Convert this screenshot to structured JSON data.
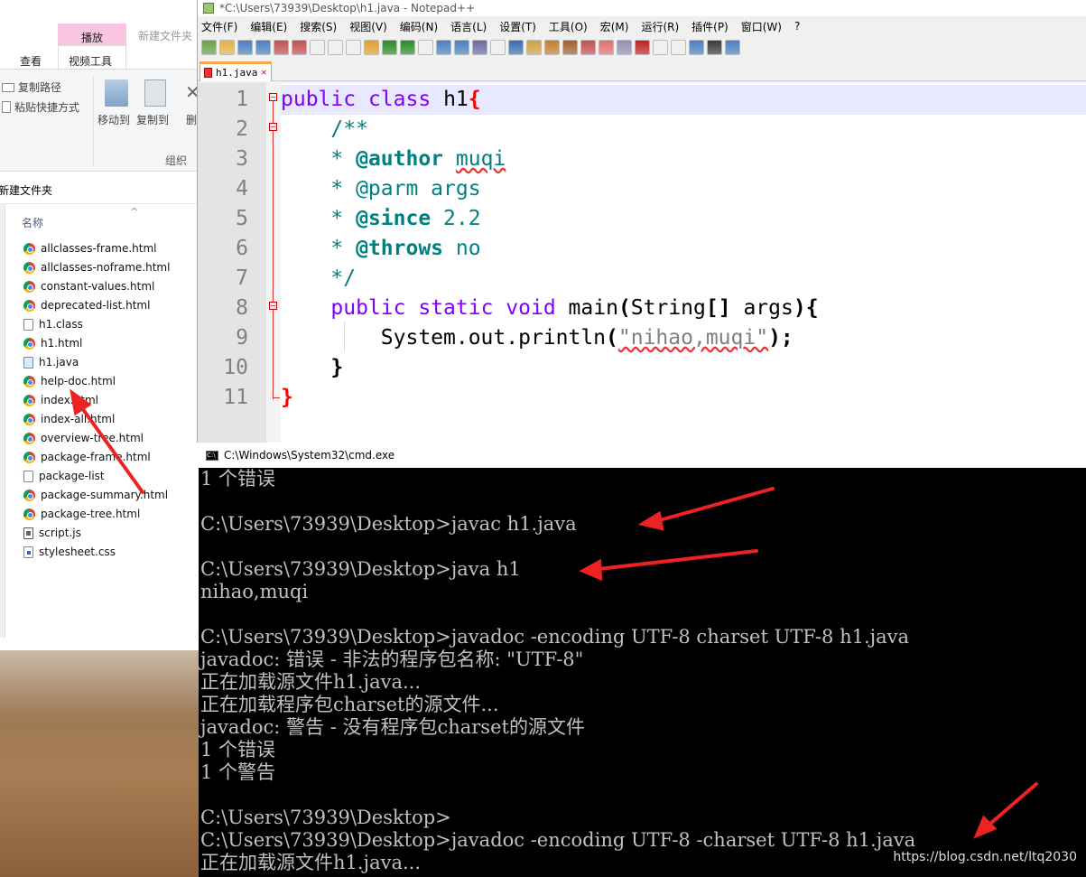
{
  "explorer": {
    "tab_play": "播放",
    "tab_newfolder": "新建文件夹",
    "tab_view": "查看",
    "tab_videotools": "视频工具",
    "ribbon_copy_path": "复制路径",
    "ribbon_paste_shortcut": "粘贴快捷方式",
    "ribbon_move_to": "移动到",
    "ribbon_copy_to": "复制到",
    "ribbon_delete": "删",
    "ribbon_group": "组织",
    "breadcrumb": "新建文件夹",
    "col_name": "名称",
    "files": [
      {
        "name": "allclasses-frame.html",
        "type": "chrome"
      },
      {
        "name": "allclasses-noframe.html",
        "type": "chrome"
      },
      {
        "name": "constant-values.html",
        "type": "chrome"
      },
      {
        "name": "deprecated-list.html",
        "type": "chrome"
      },
      {
        "name": "h1.class",
        "type": "doc"
      },
      {
        "name": "h1.html",
        "type": "chrome"
      },
      {
        "name": "h1.java",
        "type": "java"
      },
      {
        "name": "help-doc.html",
        "type": "chrome"
      },
      {
        "name": "index.html",
        "type": "chrome"
      },
      {
        "name": "index-all.html",
        "type": "chrome"
      },
      {
        "name": "overview-tree.html",
        "type": "chrome"
      },
      {
        "name": "package-frame.html",
        "type": "chrome"
      },
      {
        "name": "package-list",
        "type": "doc"
      },
      {
        "name": "package-summary.html",
        "type": "chrome"
      },
      {
        "name": "package-tree.html",
        "type": "chrome"
      },
      {
        "name": "script.js",
        "type": "js"
      },
      {
        "name": "stylesheet.css",
        "type": "css"
      }
    ]
  },
  "notepad": {
    "title": "*C:\\Users\\73939\\Desktop\\h1.java - Notepad++",
    "menu": [
      "文件(F)",
      "编辑(E)",
      "搜索(S)",
      "视图(V)",
      "编码(N)",
      "语言(L)",
      "设置(T)",
      "工具(O)",
      "宏(M)",
      "运行(R)",
      "插件(P)",
      "窗口(W)",
      "?"
    ],
    "tab_label": "h1.java",
    "line_numbers": [
      "1",
      "2",
      "3",
      "4",
      "5",
      "6",
      "7",
      "8",
      "9",
      "10",
      "11"
    ],
    "code": {
      "l1_kw1": "public",
      "l1_kw2": "class",
      "l1_name": "h1",
      "l1_brace": "{",
      "l2": "/**",
      "l3_star": "* ",
      "l3_tag": "@author",
      "l3_val": "muqi",
      "l4": "* @parm args",
      "l5_star": "* ",
      "l5_tag": "@since",
      "l5_val": "2.2",
      "l6_star": "* ",
      "l6_tag": "@throws",
      "l6_val": "no",
      "l7": "*/",
      "l8_kw1": "public",
      "l8_kw2": "static",
      "l8_kw3": "void",
      "l8_rest": "main",
      "l8_paren": "(",
      "l8_type": "String",
      "l8_arr": "[]",
      "l8_args": " args",
      "l8_close": "){",
      "l9_obj": "System.out.println",
      "l9_open": "(",
      "l9_str": "\"nihao,muqi\"",
      "l9_close": ");",
      "l10": "}",
      "l11": "}"
    }
  },
  "cmd": {
    "title": "C:\\Windows\\System32\\cmd.exe",
    "lines": [
      "1 个错误",
      "",
      "C:\\Users\\73939\\Desktop>javac h1.java",
      "",
      "C:\\Users\\73939\\Desktop>java h1",
      "nihao,muqi",
      "",
      "C:\\Users\\73939\\Desktop>javadoc -encoding UTF-8 charset UTF-8 h1.java",
      "javadoc: 错误 - 非法的程序包名称: \"UTF-8\"",
      "正在加载源文件h1.java...",
      "正在加载程序包charset的源文件...",
      "javadoc: 警告 - 没有程序包charset的源文件",
      "1 个错误",
      "1 个警告",
      "",
      "C:\\Users\\73939\\Desktop>",
      "C:\\Users\\73939\\Desktop>javadoc -encoding UTF-8 -charset UTF-8 h1.java",
      "正在加载源文件h1.java..."
    ],
    "watermark": "https://blog.csdn.net/ltq2030"
  },
  "colors": {
    "annotation_arrow": "#ee2222",
    "keyword": "#8000ff",
    "comment": "#008080",
    "play_tab": "#f9c5e0"
  }
}
